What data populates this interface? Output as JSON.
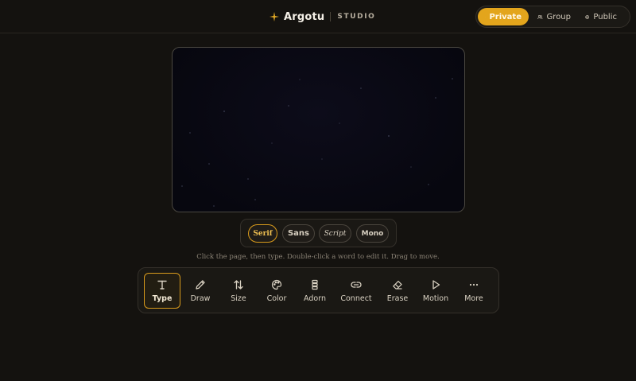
{
  "header": {
    "brand_name": "Argotu",
    "brand_sub": "STUDIO",
    "visibility": [
      {
        "label": "Private",
        "icon": "lock-icon",
        "active": true
      },
      {
        "label": "Group",
        "icon": "users-icon",
        "active": false
      },
      {
        "label": "Public",
        "icon": "globe-icon",
        "active": false
      }
    ]
  },
  "fonts": [
    {
      "label": "Serif",
      "active": true
    },
    {
      "label": "Sans",
      "active": false
    },
    {
      "label": "Script",
      "active": false
    },
    {
      "label": "Mono",
      "active": false
    }
  ],
  "hint": "Click the page, then type. Double-click a word to edit it. Drag to move.",
  "tools": [
    {
      "label": "Type",
      "icon": "type-icon",
      "active": true
    },
    {
      "label": "Draw",
      "icon": "pencil-icon",
      "active": false
    },
    {
      "label": "Size",
      "icon": "arrows-up-down-icon",
      "active": false
    },
    {
      "label": "Color",
      "icon": "palette-icon",
      "active": false
    },
    {
      "label": "Adorn",
      "icon": "adorn-icon",
      "active": false
    },
    {
      "label": "Connect",
      "icon": "link-icon",
      "active": false
    },
    {
      "label": "Erase",
      "icon": "eraser-icon",
      "active": false
    },
    {
      "label": "Motion",
      "icon": "play-icon",
      "active": false
    },
    {
      "label": "More",
      "icon": "more-icon",
      "active": false
    }
  ],
  "colors": {
    "accent": "#e3a51c",
    "background": "#14120f",
    "canvas": "#07070f"
  }
}
